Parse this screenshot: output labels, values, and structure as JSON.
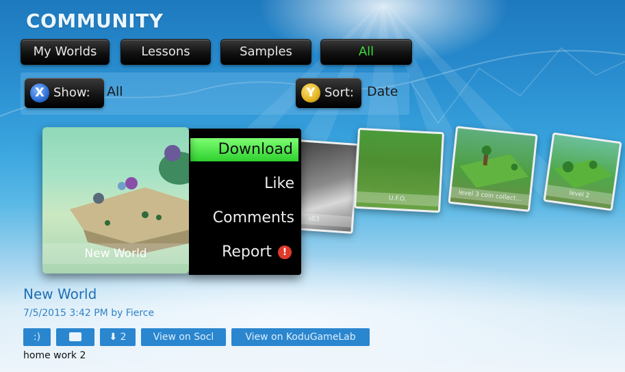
{
  "header": {
    "title": "COMMUNITY"
  },
  "tabs": [
    {
      "label": "My Worlds"
    },
    {
      "label": "Lessons"
    },
    {
      "label": "Samples"
    },
    {
      "label": "All",
      "active": true
    }
  ],
  "filters": {
    "show": {
      "key": "X",
      "label": "Show:",
      "value": "All"
    },
    "sort": {
      "key": "Y",
      "label": "Sort:",
      "value": "Date"
    }
  },
  "worlds": [
    {
      "caption": "New World",
      "selected": true
    },
    {
      "caption": "s03"
    },
    {
      "caption": "U.F.O."
    },
    {
      "caption": "level 3 coin collect..."
    },
    {
      "caption": "level 2"
    }
  ],
  "context_menu": {
    "items": [
      "Download",
      "Like",
      "Comments",
      "Report"
    ],
    "highlighted": "Download"
  },
  "details": {
    "title": "New World",
    "meta": "7/5/2015 3:42 PM by Fierce",
    "description": "home work 2",
    "actions": {
      "smile": ":)",
      "downloads": "2",
      "view_social": "View on Socl",
      "view_kgl": "View on KoduGameLab"
    }
  },
  "colors": {
    "accent_green": "#3edb3e",
    "link_blue": "#2a86cf",
    "x_button": "#2b6fd6",
    "y_button": "#e3b321",
    "report_red": "#e03a2c"
  },
  "icons": [
    "x-button-icon",
    "y-button-icon",
    "report-alert-icon",
    "comment-icon",
    "download-arrow-icon"
  ]
}
